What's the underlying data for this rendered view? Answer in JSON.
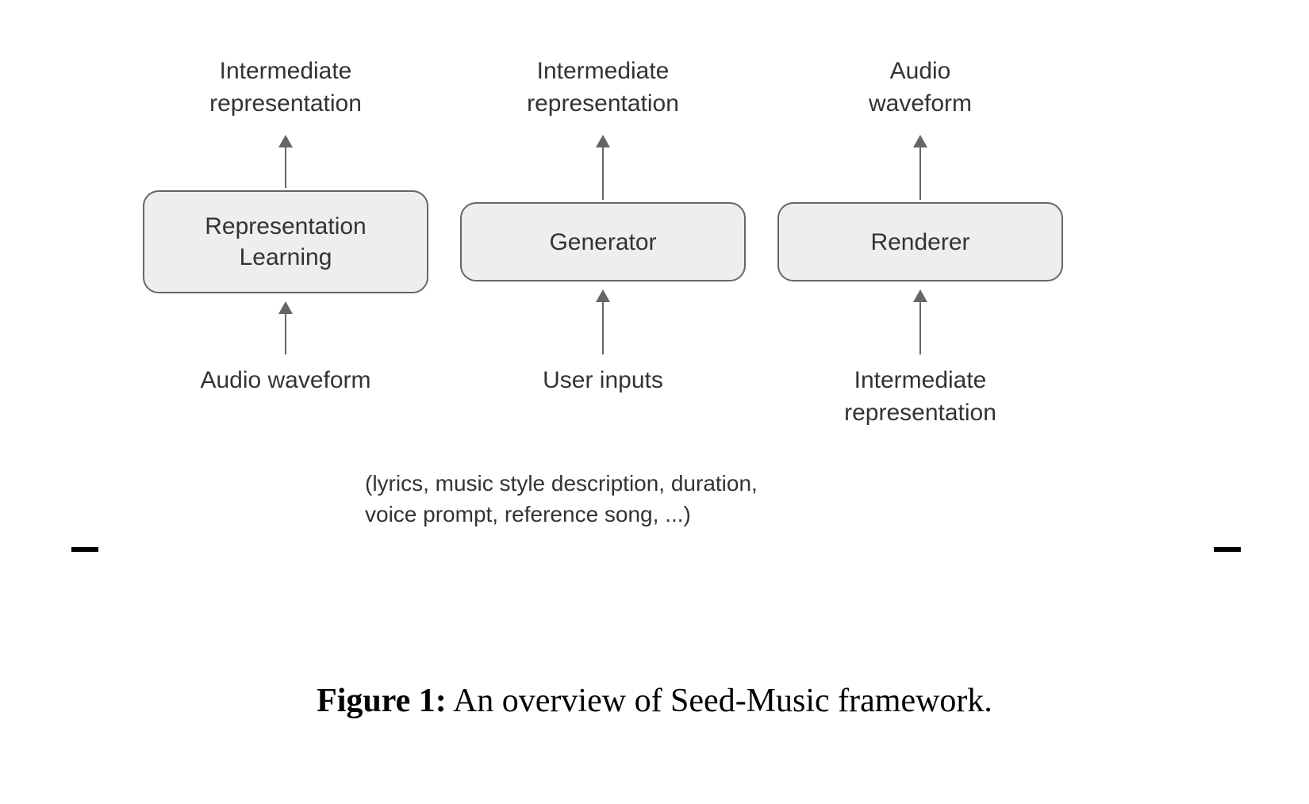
{
  "columns": [
    {
      "top_line1": "Intermediate",
      "top_line2": "representation",
      "box_line1": "Representation",
      "box_line2": "Learning",
      "bottom_line1": "Audio waveform",
      "bottom_line2": ""
    },
    {
      "top_line1": "Intermediate",
      "top_line2": "representation",
      "box_line1": "Generator",
      "box_line2": "",
      "bottom_line1": "User inputs",
      "bottom_line2": ""
    },
    {
      "top_line1": "Audio",
      "top_line2": "waveform",
      "box_line1": "Renderer",
      "box_line2": "",
      "bottom_line1": "Intermediate",
      "bottom_line2": "representation"
    }
  ],
  "note_line1": "(lyrics, music style description, duration,",
  "note_line2": "voice prompt, reference song, ...)",
  "caption_label": "Figure 1:",
  "caption_text": " An overview of Seed-Music framework."
}
